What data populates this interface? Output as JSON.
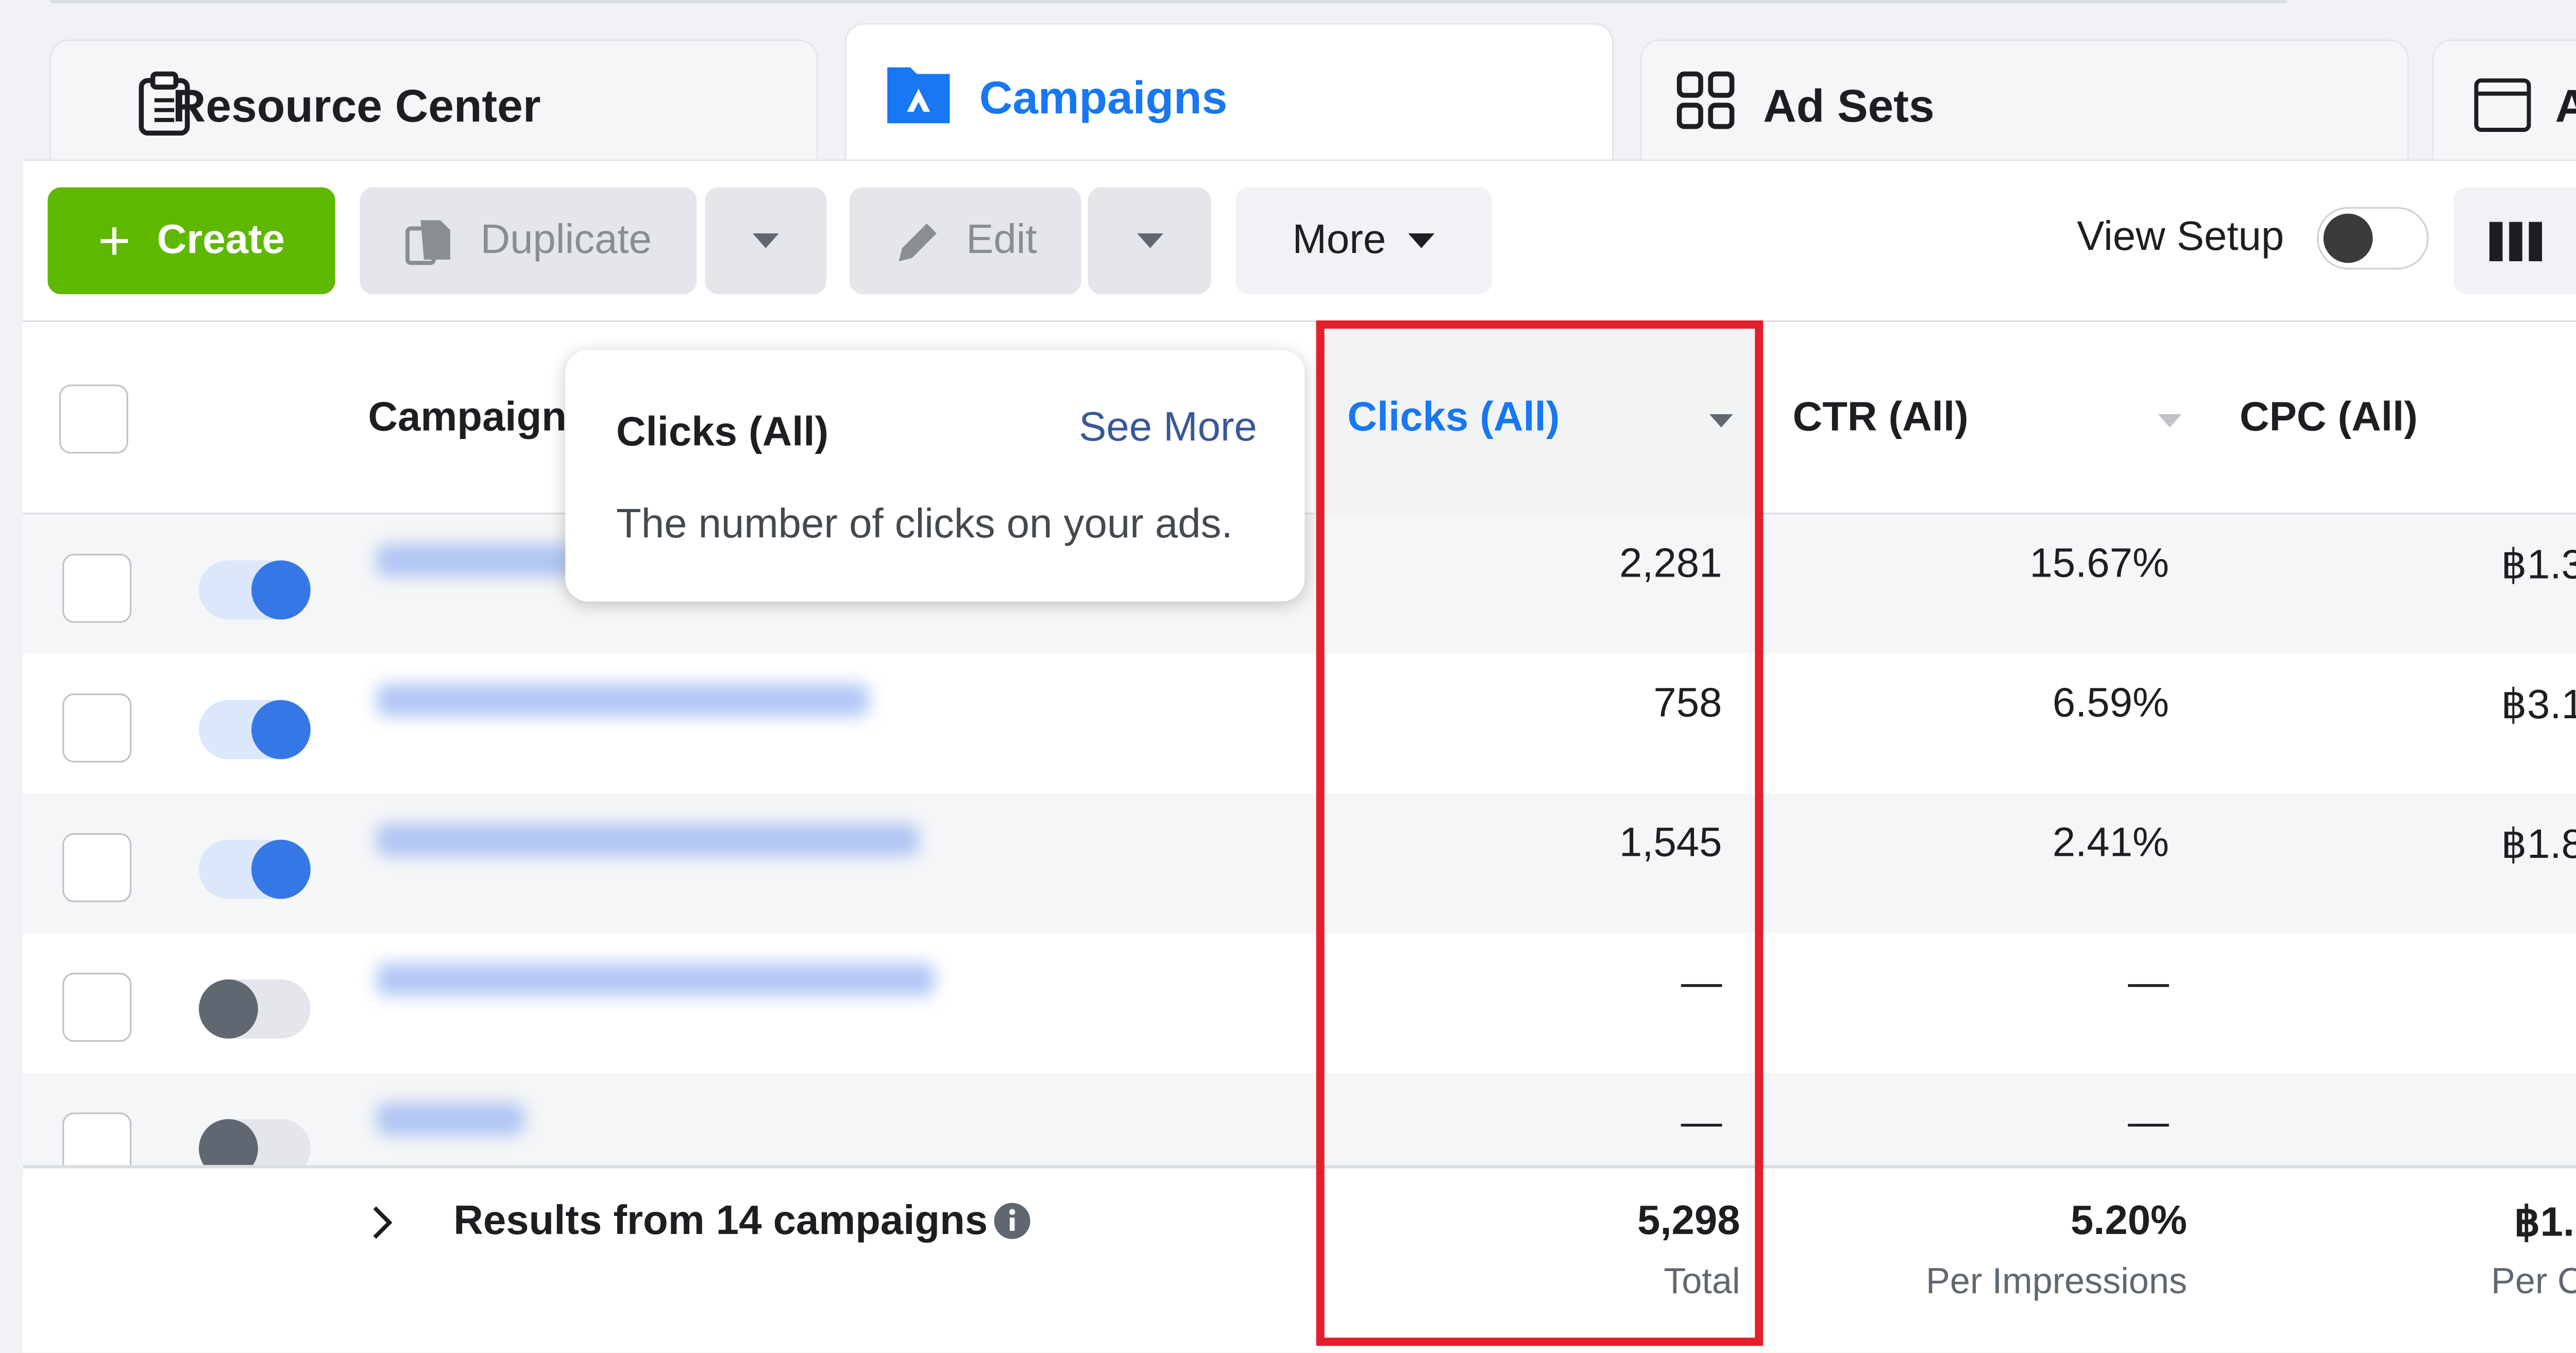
{
  "tabs": [
    {
      "label": "Resource Center",
      "icon": "clipboard-icon",
      "active": false
    },
    {
      "label": "Campaigns",
      "icon": "campaign-folder-icon",
      "active": true
    },
    {
      "label": "Ad Sets",
      "icon": "grid-icon",
      "active": false
    },
    {
      "label": "A",
      "icon": "window-icon",
      "active": false
    }
  ],
  "toolbar": {
    "create_label": "Create",
    "duplicate_label": "Duplicate",
    "edit_label": "Edit",
    "more_label": "More",
    "view_setup_label": "View Setup",
    "view_setup_on": false
  },
  "table": {
    "columns": {
      "campaign": "Campaign",
      "clicks": "Clicks (All)",
      "ctr": "CTR (All)",
      "cpc": "CPC (All)"
    },
    "rows": [
      {
        "enabled": true,
        "clicks": "2,281",
        "ctr": "15.67%",
        "cpc": "฿1.3"
      },
      {
        "enabled": true,
        "clicks": "758",
        "ctr": "6.59%",
        "cpc": "฿3.1"
      },
      {
        "enabled": true,
        "clicks": "1,545",
        "ctr": "2.41%",
        "cpc": "฿1.8"
      },
      {
        "enabled": false,
        "clicks": "—",
        "ctr": "—",
        "cpc": ""
      },
      {
        "enabled": false,
        "clicks": "—",
        "ctr": "—",
        "cpc": ""
      }
    ],
    "footer": {
      "results_label": "Results from 14 campaigns",
      "clicks_total": "5,298",
      "clicks_sub": "Total",
      "ctr_total": "5.20%",
      "ctr_sub": "Per Impressions",
      "cpc_total": "฿1.",
      "cpc_sub": "Per C"
    }
  },
  "tooltip": {
    "title": "Clicks (All)",
    "link": "See More",
    "description": "The number of clicks on your ads."
  },
  "colors": {
    "accent": "#1877f2",
    "create": "#5fb800",
    "highlight_box": "#e41e2b"
  }
}
